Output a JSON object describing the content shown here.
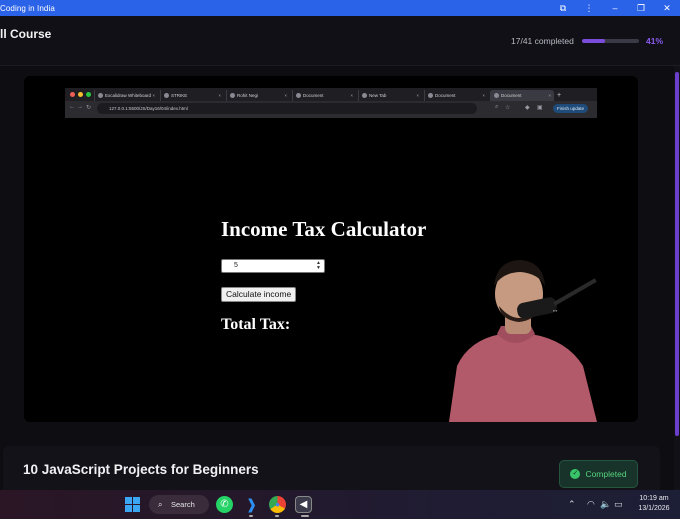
{
  "window": {
    "title": "Coding in India",
    "controls": {
      "extensions": "⧉",
      "menu": "⋮",
      "minimize": "–",
      "restore": "❐",
      "close": "✕"
    }
  },
  "header": {
    "course_title": "ll Course",
    "progress_text": "17/41 completed",
    "progress_fraction": 0.41,
    "progress_percent": "41%"
  },
  "video": {
    "browser": {
      "tabs": [
        {
          "label": "Excalidraw Whiteboard",
          "active": false
        },
        {
          "label": "STRIKE",
          "active": false
        },
        {
          "label": "Rohit Negi",
          "active": false
        },
        {
          "label": "Document",
          "active": false
        },
        {
          "label": "New Tab",
          "active": false
        },
        {
          "label": "Document",
          "active": false
        },
        {
          "label": "Document",
          "active": true
        }
      ],
      "new_tab": "+",
      "url": "127.0.0.1:5500/JS/Day16/04/index.html",
      "finish_update": "Finish update"
    },
    "page": {
      "heading": "Income Tax Calculator",
      "input_value": "5",
      "button_label": "Calculate income",
      "total_label": "Total Tax:"
    }
  },
  "lesson": {
    "title": "10 JavaScript Projects for Beginners",
    "status_label": "Completed"
  },
  "taskbar": {
    "search_label": "Search",
    "time": "10:19 am",
    "date": "13/1/2026"
  },
  "colors": {
    "titlebar": "#2a62e8",
    "accent": "#7c4ddc",
    "completed_green": "#39c46a"
  }
}
